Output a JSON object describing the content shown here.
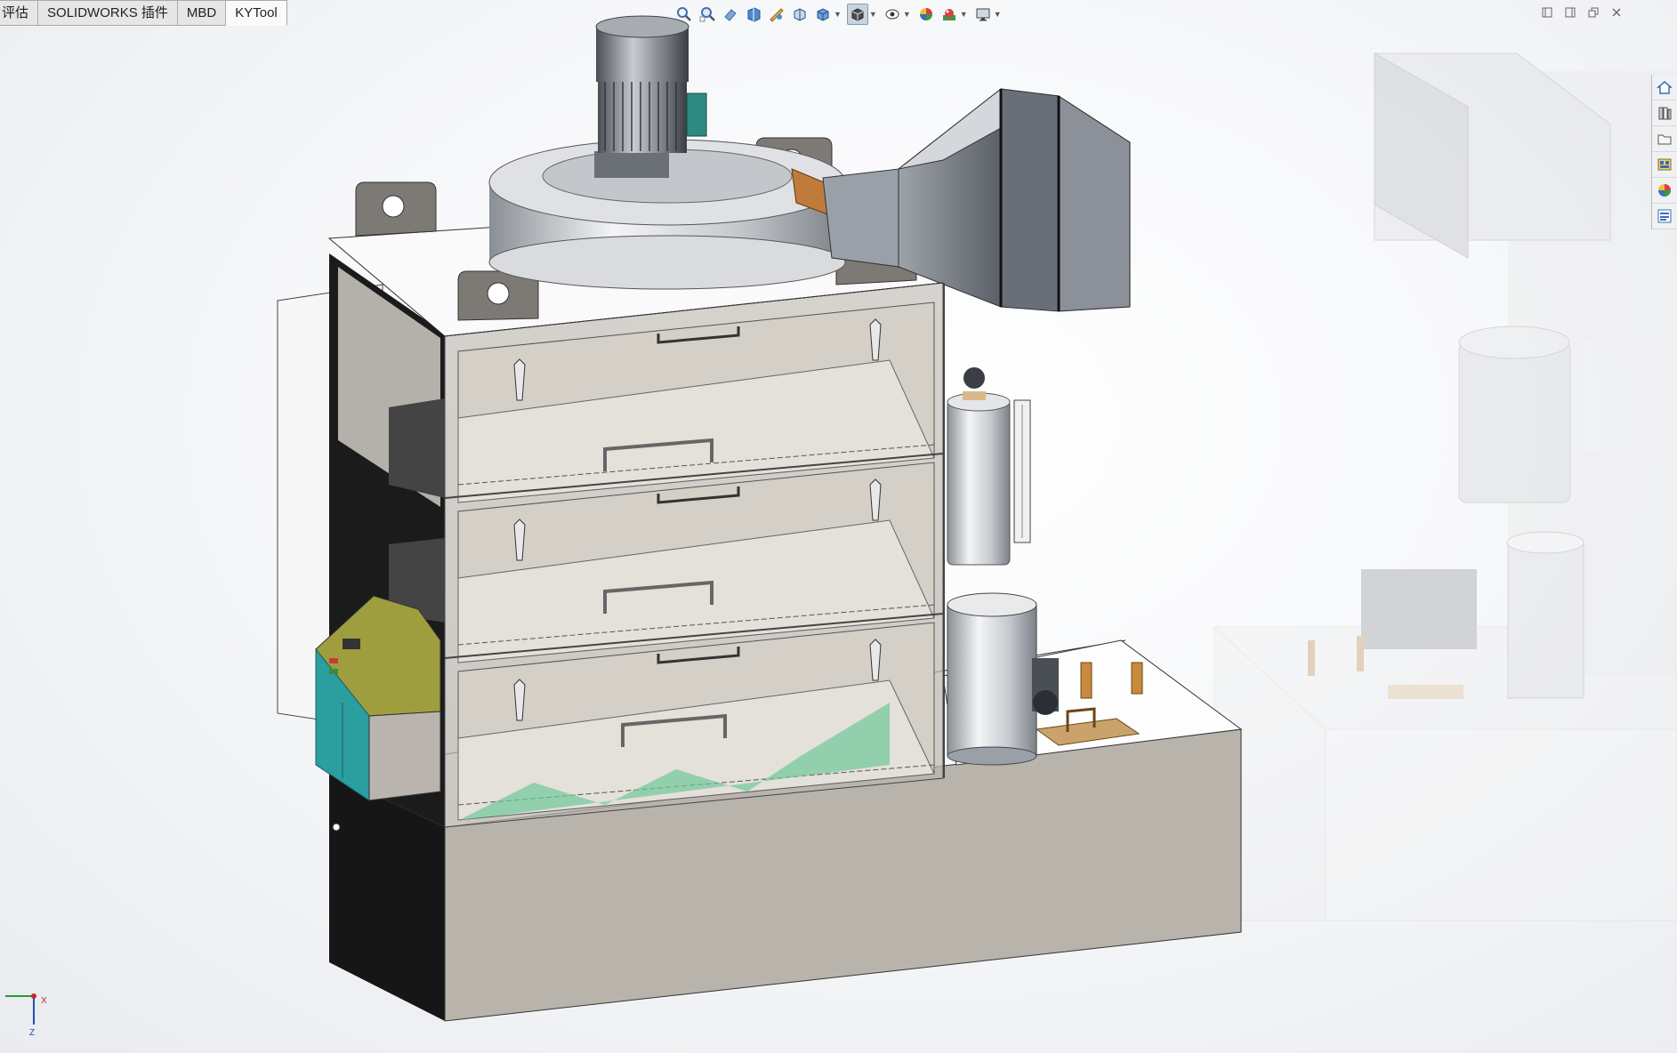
{
  "command_manager": {
    "tabs": [
      {
        "label": "评估",
        "active": false
      },
      {
        "label": "SOLIDWORKS 插件",
        "active": false
      },
      {
        "label": "MBD",
        "active": false
      },
      {
        "label": "KYTool",
        "active": true
      }
    ]
  },
  "heads_up_toolbar": {
    "tools": [
      "zoom-to-fit-icon",
      "zoom-to-area-icon",
      "previous-view-icon",
      "section-view-icon",
      "dynamic-annotation-icon",
      "view-orientation-icon",
      "display-style-icon",
      "hide-show-items-icon",
      "edit-appearance-icon",
      "apply-scene-icon",
      "view-settings-icon"
    ]
  },
  "window_controls": [
    "tile-horizontal-icon",
    "tile-vertical-icon",
    "restore-icon",
    "close-icon"
  ],
  "task_pane": {
    "buttons": [
      "solidworks-resources-icon",
      "design-library-icon",
      "file-explorer-icon",
      "view-palette-icon",
      "appearances-scenes-icon",
      "custom-properties-icon"
    ]
  },
  "triad": {
    "x_label": "X",
    "z_label": "Z"
  },
  "colors": {
    "accent_blue": "#1e5aa8",
    "control_box_yellow": "#9e9e3e",
    "control_box_teal": "#2b9ea0",
    "frame_dark": "#1b1b1b",
    "cabinet_grey": "#b8b4ac"
  }
}
